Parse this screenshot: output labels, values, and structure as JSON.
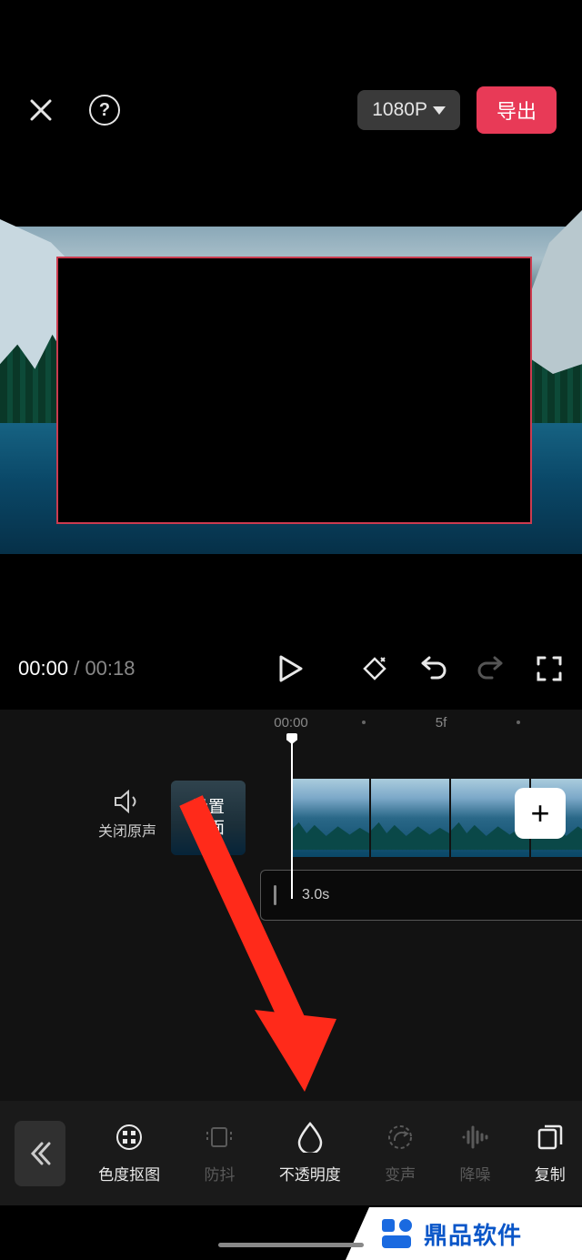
{
  "header": {
    "resolution": "1080P",
    "export": "导出"
  },
  "playback": {
    "current": "00:00",
    "total": "00:18",
    "separator": "/"
  },
  "ruler": {
    "t0": "00:00",
    "t1": "5f"
  },
  "mute": {
    "label": "关闭原声"
  },
  "cover": {
    "label": "设置\n封面"
  },
  "subtrack": {
    "duration": "3.0s"
  },
  "addclip": {
    "glyph": "+"
  },
  "tools": [
    {
      "key": "chroma",
      "label": "色度抠图",
      "disabled": false
    },
    {
      "key": "stable",
      "label": "防抖",
      "disabled": true
    },
    {
      "key": "opacity",
      "label": "不透明度",
      "disabled": false
    },
    {
      "key": "voice",
      "label": "变声",
      "disabled": true
    },
    {
      "key": "denoise",
      "label": "降噪",
      "disabled": true
    },
    {
      "key": "copy",
      "label": "复制",
      "disabled": false
    }
  ],
  "watermark": "鼎品软件"
}
